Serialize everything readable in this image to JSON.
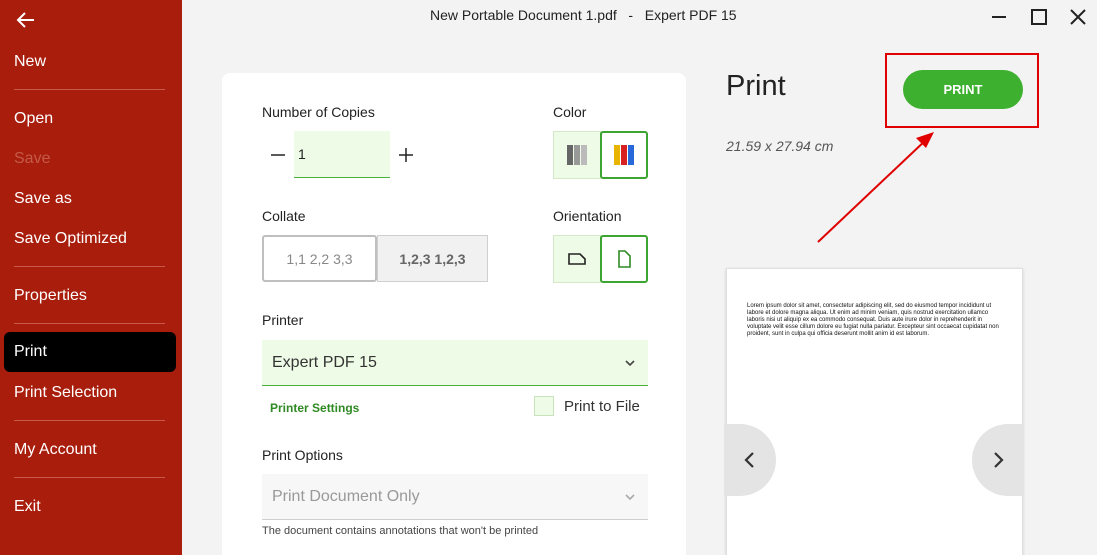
{
  "window": {
    "title": "New Portable Document 1.pdf   -   Expert PDF 15"
  },
  "sidebar": {
    "items": [
      {
        "label": "New"
      },
      {
        "label": "Open"
      },
      {
        "label": "Save"
      },
      {
        "label": "Save as"
      },
      {
        "label": "Save Optimized"
      },
      {
        "label": "Properties"
      },
      {
        "label": "Print"
      },
      {
        "label": "Print Selection"
      },
      {
        "label": "My Account"
      },
      {
        "label": "Exit"
      }
    ],
    "active": "Print",
    "disabled": [
      "Save"
    ]
  },
  "settings": {
    "copies_label": "Number of Copies",
    "copies_value": "1",
    "color_label": "Color",
    "collate_label": "Collate",
    "collate_options": [
      "1,1 2,2 3,3",
      "1,2,3 1,2,3"
    ],
    "orientation_label": "Orientation",
    "printer_label": "Printer",
    "printer_value": "Expert PDF 15",
    "printer_settings_link": "Printer Settings",
    "print_to_file_label": "Print to File",
    "print_options_label": "Print Options",
    "print_options_value": "Print Document Only",
    "annotations_note": "The document contains annotations that won't be printed"
  },
  "preview": {
    "heading": "Print",
    "page_size": "21.59 x 27.94 cm",
    "print_button": "PRINT",
    "page_text": "Lorem ipsum dolor sit amet, consectetur adipiscing elit, sed do eiusmod tempor incididunt ut labore et dolore magna aliqua. Ut enim ad minim veniam, quis nostrud exercitation ullamco laboris nisi ut aliquip ex ea commodo consequat. Duis aute irure dolor in reprehenderit in voluptate velit esse cillum dolore eu fugiat nulla pariatur. Excepteur sint occaecat cupidatat non proident, sunt in culpa qui officia deserunt mollit anim id est laborum."
  },
  "colors": {
    "sidebar_bg": "#a81d0c",
    "accent_green": "#3db02f",
    "highlight_red": "#e00000"
  }
}
